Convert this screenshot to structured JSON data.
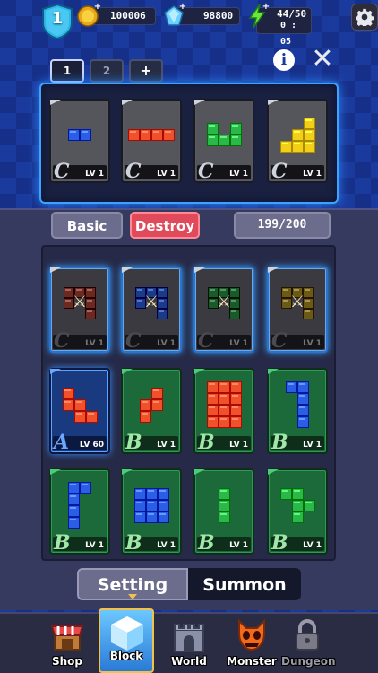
{
  "topbar": {
    "level": "1",
    "coins": "100006",
    "gems": "98800",
    "energy": "44/50",
    "energy_timer": "0 : 05",
    "plus_symbol": "+"
  },
  "presets": {
    "tabs": [
      "1",
      "2"
    ],
    "add_label": "+",
    "active_index": 0
  },
  "header_buttons": {
    "info_label": "i",
    "close_label": "✕"
  },
  "equipped": [
    {
      "grade": "C",
      "level": "LV 1",
      "color": "#2a5ee6",
      "shape": "domino"
    },
    {
      "grade": "C",
      "level": "LV 1",
      "color": "#f0502a",
      "shape": "line4"
    },
    {
      "grade": "C",
      "level": "LV 1",
      "color": "#2ab84a",
      "shape": "L"
    },
    {
      "grade": "C",
      "level": "LV 1",
      "color": "#f2d018",
      "shape": "stair"
    }
  ],
  "filters": {
    "basic_label": "Basic",
    "destroy_label": "Destroy",
    "count": "199/200"
  },
  "inventory": {
    "row1": [
      {
        "grade": "C",
        "level": "LV 1",
        "color": "#6a2a22",
        "equipped": true
      },
      {
        "grade": "C",
        "level": "LV 1",
        "color": "#1a3a8a",
        "equipped": true
      },
      {
        "grade": "C",
        "level": "LV 1",
        "color": "#1a5a2a",
        "equipped": true
      },
      {
        "grade": "C",
        "level": "LV 1",
        "color": "#6a5a16",
        "equipped": true
      }
    ],
    "row2": [
      {
        "grade": "A",
        "level": "LV 60",
        "color": "#f0502a",
        "style": "blue"
      },
      {
        "grade": "B",
        "level": "LV 1",
        "color": "#f0502a",
        "style": "green"
      },
      {
        "grade": "B",
        "level": "LV 1",
        "color": "#f0502a",
        "style": "green"
      },
      {
        "grade": "B",
        "level": "LV 1",
        "color": "#2a5ee6",
        "style": "green"
      }
    ],
    "row3": [
      {
        "grade": "B",
        "level": "LV 1",
        "color": "#2a5ee6",
        "style": "green"
      },
      {
        "grade": "B",
        "level": "LV 1",
        "color": "#2a5ee6",
        "style": "green"
      },
      {
        "grade": "B",
        "level": "LV 1",
        "color": "#2ab84a",
        "style": "green"
      },
      {
        "grade": "B",
        "level": "LV 1",
        "color": "#2ab84a",
        "style": "green"
      }
    ]
  },
  "mode_tabs": {
    "setting_label": "Setting",
    "summon_label": "Summon"
  },
  "nav": {
    "shop": "Shop",
    "block": "Block",
    "world": "World",
    "monster": "Monster",
    "dungeon": "Dungeon"
  },
  "icons": {
    "equipped_mark": "⚔"
  }
}
